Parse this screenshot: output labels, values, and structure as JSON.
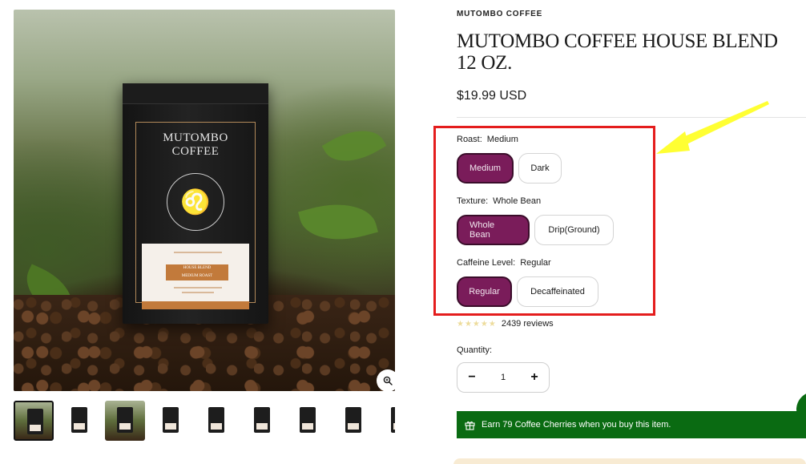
{
  "gallery": {
    "bag_brand": "MUTOMBO\nCOFFEE",
    "label_text": "HOUSE BLEND\nMEDIUM ROAST",
    "zoom_icon": "magnifier-icon",
    "thumbnails": [
      "bag-dark",
      "bag-white",
      "bag-photo",
      "bag-white",
      "bag-white",
      "bag-white",
      "bag-white",
      "bag-white",
      "bag-white"
    ]
  },
  "product": {
    "vendor": "MUTOMBO COFFEE",
    "title": "MUTOMBO COFFEE HOUSE BLEND 12 OZ.",
    "price": "$19.99 USD"
  },
  "options": {
    "roast": {
      "label": "Roast:",
      "selected": "Medium",
      "values": [
        "Medium",
        "Dark"
      ]
    },
    "texture": {
      "label": "Texture:",
      "selected": "Whole Bean",
      "values": [
        "Whole Bean",
        "Drip(Ground)"
      ]
    },
    "caffeine": {
      "label": "Caffeine Level:",
      "selected": "Regular",
      "values": [
        "Regular",
        "Decaffeinated"
      ]
    }
  },
  "rating": {
    "stars": "★★★★★",
    "reviews": "2439 reviews"
  },
  "quantity": {
    "label": "Quantity:",
    "value": "1",
    "minus": "−",
    "plus": "+"
  },
  "rewards": {
    "text": "Earn 79 Coffee Cherries when you buy this item.",
    "icon": "gift-icon"
  },
  "colors": {
    "accent": "#7a1c5a",
    "rewards_bg": "#0a6b12",
    "highlight": "#e41d1d",
    "arrow": "#ffff33"
  }
}
